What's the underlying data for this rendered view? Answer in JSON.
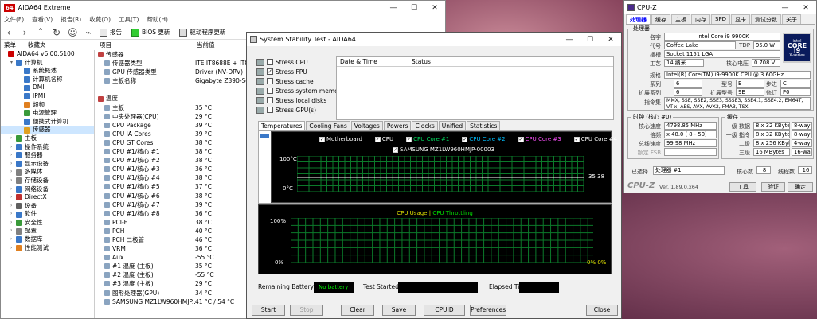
{
  "aida": {
    "title": "AIDA64 Extreme",
    "menu": [
      "文件(F)",
      "查看(V)",
      "报告(R)",
      "收藏(O)",
      "工具(T)",
      "帮助(H)"
    ],
    "toolbar": {
      "report": "报告",
      "bios": "BIOS 更新",
      "driver": "驱动程序更新"
    },
    "left_tabs": [
      "菜单",
      "收藏夹"
    ],
    "col_item": "项目",
    "col_value": "当前值",
    "tree": [
      {
        "label": "AIDA64 v6.00.5100",
        "lvl": 0,
        "c": "#c00"
      },
      {
        "label": "计算机",
        "lvl": 1,
        "c": "#3a78c8"
      },
      {
        "label": "系统概述",
        "lvl": 2,
        "c": "#3a78c8"
      },
      {
        "label": "计算机名称",
        "lvl": 2,
        "c": "#3a78c8"
      },
      {
        "label": "DMI",
        "lvl": 2,
        "c": "#3a78c8"
      },
      {
        "label": "IPMI",
        "lvl": 2,
        "c": "#3a78c8"
      },
      {
        "label": "超频",
        "lvl": 2,
        "c": "#e08020"
      },
      {
        "label": "电源管理",
        "lvl": 2,
        "c": "#3a9a3a"
      },
      {
        "label": "便携式计算机",
        "lvl": 2,
        "c": "#3a78c8"
      },
      {
        "label": "传感器",
        "lvl": 2,
        "c": "#e0a020",
        "sel": true
      },
      {
        "label": "主板",
        "lvl": 1,
        "c": "#3a9a3a"
      },
      {
        "label": "操作系统",
        "lvl": 1,
        "c": "#3a78c8"
      },
      {
        "label": "服务器",
        "lvl": 1,
        "c": "#3a78c8"
      },
      {
        "label": "显示设备",
        "lvl": 1,
        "c": "#3a78c8"
      },
      {
        "label": "多媒体",
        "lvl": 1,
        "c": "#808080"
      },
      {
        "label": "存储设备",
        "lvl": 1,
        "c": "#808080"
      },
      {
        "label": "网络设备",
        "lvl": 1,
        "c": "#3a78c8"
      },
      {
        "label": "DirectX",
        "lvl": 1,
        "c": "#c03030"
      },
      {
        "label": "设备",
        "lvl": 1,
        "c": "#606060"
      },
      {
        "label": "软件",
        "lvl": 1,
        "c": "#3a78c8"
      },
      {
        "label": "安全性",
        "lvl": 1,
        "c": "#3a9a3a"
      },
      {
        "label": "配置",
        "lvl": 1,
        "c": "#808080"
      },
      {
        "label": "数据库",
        "lvl": 1,
        "c": "#3a78c8"
      },
      {
        "label": "性能测试",
        "lvl": 1,
        "c": "#e08020"
      }
    ],
    "rows": [
      {
        "k": "传感器",
        "v": "",
        "g": 1
      },
      {
        "k": "传感器类型",
        "v": "ITE IT8688E + IT8795E",
        "s": 1
      },
      {
        "k": "GPU 传感器类型",
        "v": "Driver (NV-DRV)",
        "s": 1
      },
      {
        "k": "主板名称",
        "v": "Gigabyte Z390-Series",
        "s": 1
      },
      {
        "k": "",
        "v": ""
      },
      {
        "k": "温度",
        "v": "",
        "g": 1
      },
      {
        "k": "主板",
        "v": "35 °C",
        "s": 1
      },
      {
        "k": "中央处理器(CPU)",
        "v": "29 °C",
        "s": 1
      },
      {
        "k": "CPU Package",
        "v": "39 °C",
        "s": 1
      },
      {
        "k": "CPU IA Cores",
        "v": "39 °C",
        "s": 1
      },
      {
        "k": "CPU GT Cores",
        "v": "38 °C",
        "s": 1
      },
      {
        "k": "CPU #1/核心 #1",
        "v": "38 °C",
        "s": 1
      },
      {
        "k": "CPU #1/核心 #2",
        "v": "38 °C",
        "s": 1
      },
      {
        "k": "CPU #1/核心 #3",
        "v": "36 °C",
        "s": 1
      },
      {
        "k": "CPU #1/核心 #4",
        "v": "38 °C",
        "s": 1
      },
      {
        "k": "CPU #1/核心 #5",
        "v": "37 °C",
        "s": 1
      },
      {
        "k": "CPU #1/核心 #6",
        "v": "38 °C",
        "s": 1
      },
      {
        "k": "CPU #1/核心 #7",
        "v": "39 °C",
        "s": 1
      },
      {
        "k": "CPU #1/核心 #8",
        "v": "36 °C",
        "s": 1
      },
      {
        "k": "PCI-E",
        "v": "38 °C",
        "s": 1
      },
      {
        "k": "PCH",
        "v": "40 °C",
        "s": 1
      },
      {
        "k": "PCH 二极管",
        "v": "46 °C",
        "s": 1
      },
      {
        "k": "VRM",
        "v": "36 °C",
        "s": 1
      },
      {
        "k": "Aux",
        "v": "-55 °C",
        "s": 1
      },
      {
        "k": "#1 温度 (主板)",
        "v": "35 °C",
        "s": 1
      },
      {
        "k": "#2 温度 (主板)",
        "v": "-55 °C",
        "s": 1
      },
      {
        "k": "#3 温度 (主板)",
        "v": "29 °C",
        "s": 1
      },
      {
        "k": "图形处理器(GPU)",
        "v": "34 °C",
        "s": 1
      },
      {
        "k": "SAMSUNG MZ1LW960HMJP...",
        "v": "41 °C / 54 °C",
        "s": 1
      }
    ]
  },
  "sst": {
    "title": "System Stability Test - AIDA64",
    "stress": [
      {
        "label": "Stress CPU",
        "checked": false
      },
      {
        "label": "Stress FPU",
        "checked": true
      },
      {
        "label": "Stress cache",
        "checked": false
      },
      {
        "label": "Stress system memory",
        "checked": false
      },
      {
        "label": "Stress local disks",
        "checked": false
      },
      {
        "label": "Stress GPU(s)",
        "checked": false
      }
    ],
    "log_cols": [
      "Date & Time",
      "Status"
    ],
    "tabs": [
      "Temperatures",
      "Cooling Fans",
      "Voltages",
      "Powers",
      "Clocks",
      "Unified",
      "Statistics"
    ],
    "temp_legend": [
      {
        "label": "Motherboard",
        "color": "#ffffff"
      },
      {
        "label": "CPU",
        "color": "#ffffff"
      },
      {
        "label": "CPU Core #1",
        "color": "#00e060"
      },
      {
        "label": "CPU Core #2",
        "color": "#00c0ff"
      },
      {
        "label": "CPU Core #3",
        "color": "#ff50ff"
      },
      {
        "label": "CPU Core #4",
        "color": "#ffffff"
      }
    ],
    "temp_legend2": "SAMSUNG MZ1LW960HMJP-00003",
    "temp_top": "100°C",
    "temp_bot": "0°C",
    "temp_readout": "35 38",
    "usage_title": "CPU Usage",
    "usage_sep": "|",
    "throttle_title": "CPU Throttling",
    "usage_top": "100%",
    "usage_bot": "0%",
    "usage_right": "0% 0%",
    "remaining_label": "Remaining Battery:",
    "remaining_value": "No battery",
    "started_label": "Test Started:",
    "elapsed_label": "Elapsed Time:",
    "buttons": [
      "Start",
      "Stop",
      "Clear",
      "Save",
      "CPUID",
      "Preferences",
      "Close"
    ],
    "colors": {
      "usage": "#e0e000",
      "throttle": "#00e000",
      "grid": "#0b7a2a"
    }
  },
  "cpuz": {
    "title": "CPU-Z",
    "tabs": [
      "处理器",
      "缓存",
      "主板",
      "内存",
      "SPD",
      "显卡",
      "测试分数",
      "关于"
    ],
    "proc_legend": "处理器",
    "fields": {
      "name_l": "名字",
      "name": "Intel Core i9 9900K",
      "code_l": "代号",
      "code": "Coffee Lake",
      "tdp_l": "TDP",
      "tdp": "95.0 W",
      "sock_l": "插槽",
      "sock": "Socket 1151 LGA",
      "proc_l": "工艺",
      "proc": "14 纳米",
      "volt_l": "核心电压",
      "volt": "0.708 V",
      "spec_l": "规格",
      "spec": "Intel(R) Core(TM) i9-9900K CPU @ 3.60GHz",
      "fam_l": "系列",
      "fam": "6",
      "mod_l": "型号",
      "mod": "E",
      "step_l": "步进",
      "step": "C",
      "efam_l": "扩展系列",
      "efam": "6",
      "emod_l": "扩展型号",
      "emod": "9E",
      "rev_l": "修订",
      "rev": "P0",
      "ins_l": "指令集",
      "ins": "MMX, SSE, SSE2, SSE3, SSSE3, SSE4.1, SSE4.2, EM64T, VT-x, AES, AVX, AVX2, FMA3, TSX"
    },
    "clock_legend": "时钟 (核心 #0)",
    "cache_legend": "缓存",
    "clock": {
      "cs_l": "核心速度",
      "cs": "4798.85 MHz",
      "mul_l": "倍频",
      "mul": "x 48.0 ( 8 - 50)",
      "bus_l": "总线速度",
      "bus": "99.98 MHz",
      "fsb_l": "额定 FSB",
      "fsb": ""
    },
    "cache": [
      {
        "l": "一级 数据",
        "v": "8 x 32 KBytes",
        "w": "8-way"
      },
      {
        "l": "一级 指令",
        "v": "8 x 32 KBytes",
        "w": "8-way"
      },
      {
        "l": "二级",
        "v": "8 x 256 KBytes",
        "w": "4-way"
      },
      {
        "l": "三级",
        "v": "16 MBytes",
        "w": "16-way"
      }
    ],
    "sel_l": "已选择",
    "sel": "处理器 #1",
    "cores_l": "核心数",
    "cores": "8",
    "threads_l": "线程数",
    "threads": "16",
    "brand": "CPU-Z",
    "ver": "Ver. 1.89.0.x64",
    "tools": "工具",
    "verify": "验证",
    "ok": "确定",
    "intel": {
      "t1": "intel",
      "t2": "CORE i9",
      "t3": "X-series"
    }
  }
}
